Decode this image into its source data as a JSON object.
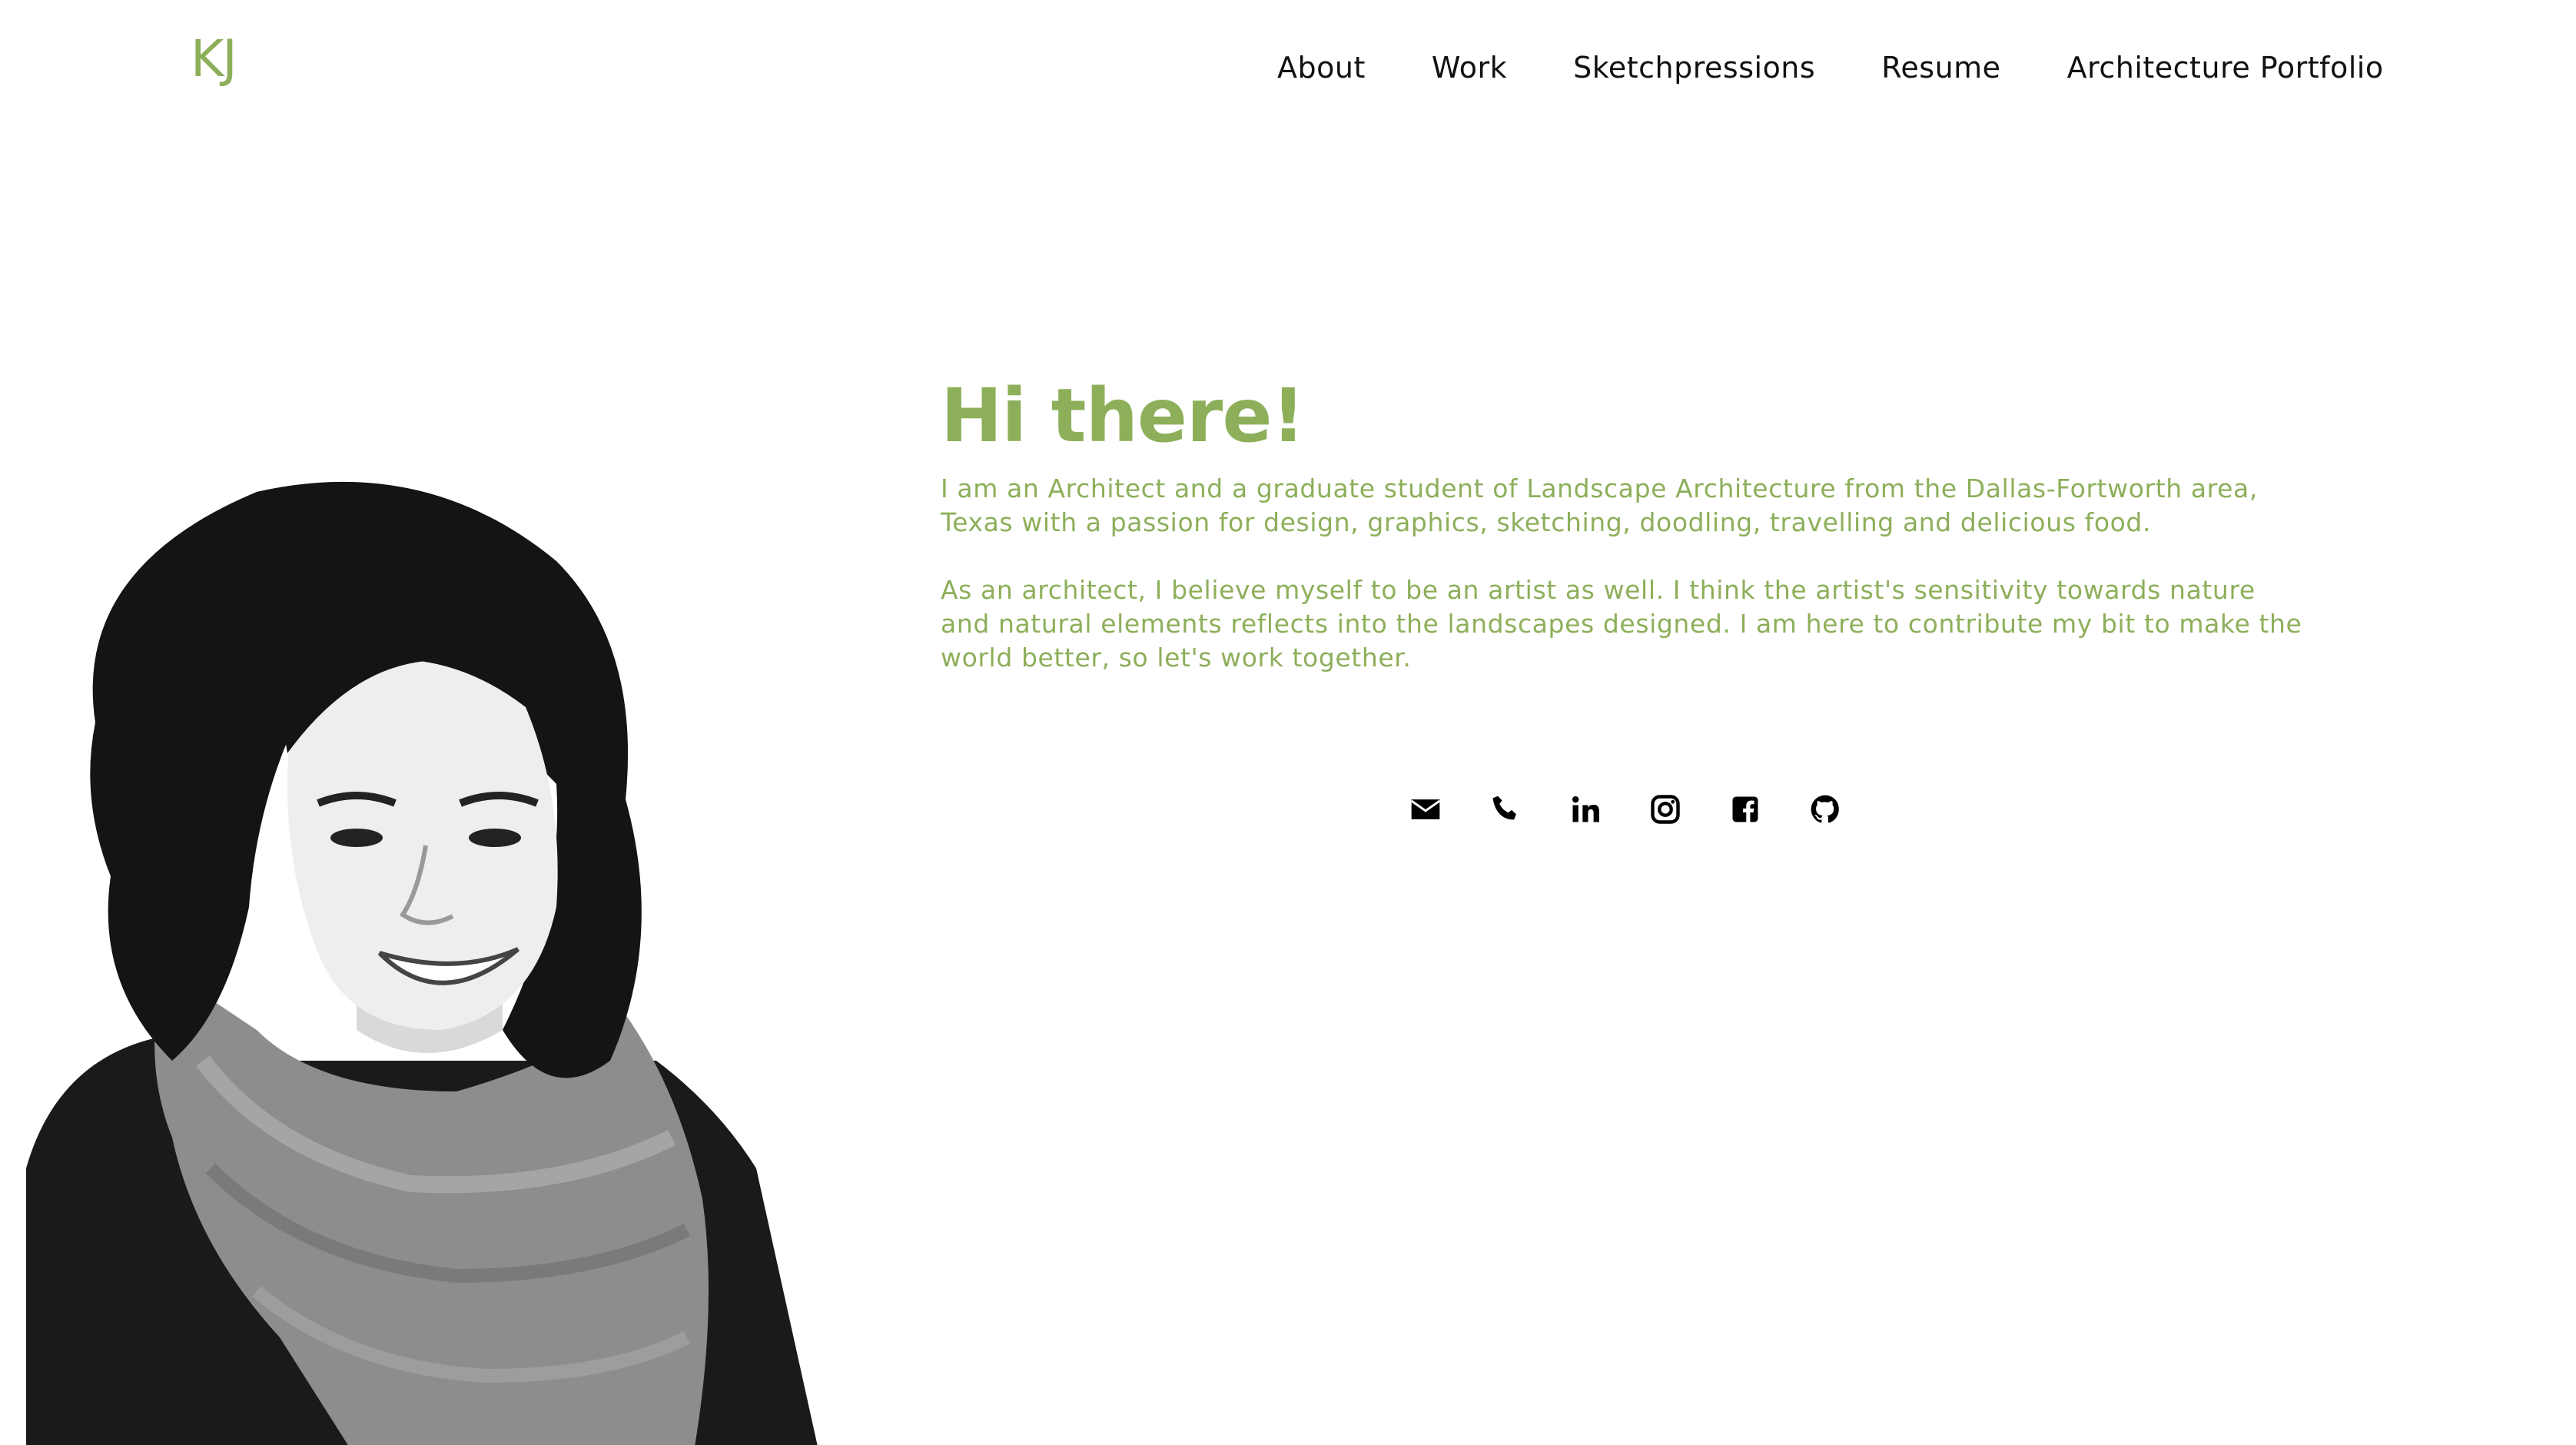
{
  "header": {
    "logo": "KJ",
    "nav": [
      {
        "label": "About"
      },
      {
        "label": "Work"
      },
      {
        "label": "Sketchpressions"
      },
      {
        "label": "Resume"
      },
      {
        "label": "Architecture Portfolio"
      }
    ]
  },
  "intro": {
    "greeting": "Hi there!",
    "paragraph1": "I am an Architect and a graduate student of Landscape Architecture from the Dallas-Fortworth area, Texas with a passion for design, graphics, sketching, doodling, travelling and delicious food.",
    "paragraph2": "As an architect, I believe myself to be an artist as well. I think the artist's sensitivity towards nature and natural elements reflects into the landscapes designed. I am here to contribute my bit to make the world better, so let's work together."
  },
  "social": [
    {
      "icon": "envelope-icon"
    },
    {
      "icon": "phone-icon"
    },
    {
      "icon": "linkedin-icon"
    },
    {
      "icon": "instagram-icon"
    },
    {
      "icon": "facebook-icon"
    },
    {
      "icon": "github-icon"
    }
  ],
  "colors": {
    "accent": "#8daf5a",
    "nav_text": "#111111",
    "background": "#ffffff"
  }
}
